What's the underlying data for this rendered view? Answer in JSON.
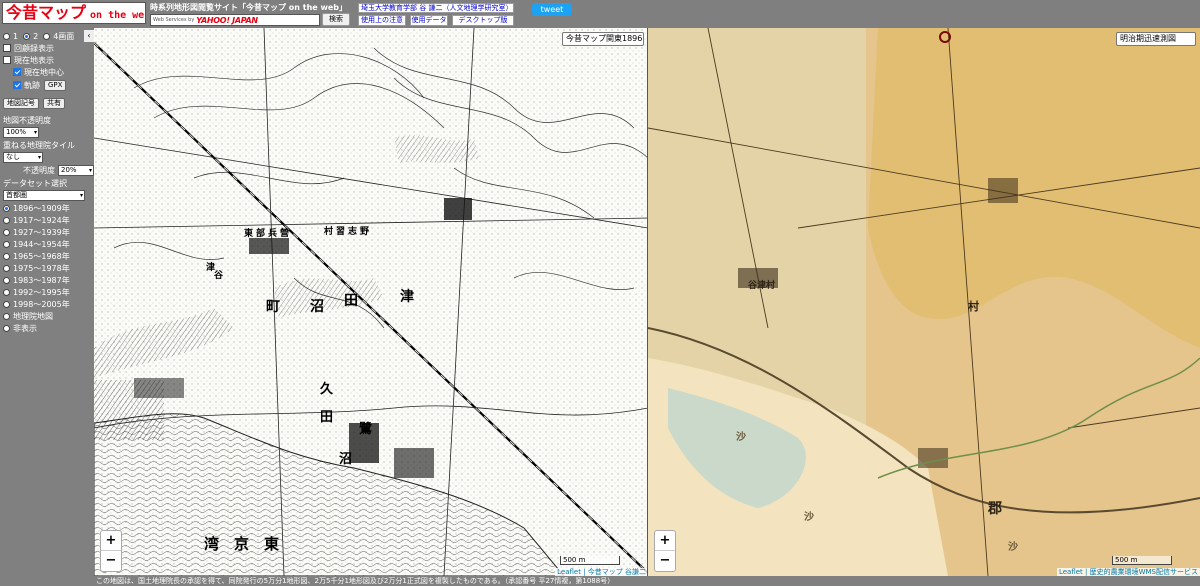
{
  "header": {
    "logo_main": "今昔マップ",
    "logo_sub": "on the web",
    "site_title": "時系列地形図閲覧サイト「今昔マップ on the web」",
    "yahoo_credit": "Web Services by",
    "yahoo_logo": "YAHOO! JAPAN",
    "search_value": "",
    "search_label": "検索",
    "author_link": "埼玉大学教育学部 谷 謙二（人文地理学研究室）",
    "notes_label": "使用上の注意",
    "data_label": "使用データ",
    "desktop_label": "デスクトップ版",
    "tweet_label": "tweet"
  },
  "sidebar": {
    "screen_options": [
      "1",
      "2",
      "4画面"
    ],
    "screen_selected": "2",
    "checks": [
      {
        "label": "回顧録表示",
        "checked": false
      },
      {
        "label": "現在地表示",
        "checked": false
      },
      {
        "label": "現在地中心",
        "checked": true
      },
      {
        "label": "軌跡",
        "checked": true
      }
    ],
    "gpx_label": "GPX",
    "legend_label": "地図記号",
    "share_label": "共有",
    "opacity_label": "地図不透明度",
    "opacity_value": "100%",
    "overlay_label": "重ねる地理院タイル",
    "overlay_value": "なし",
    "overlay_opacity_label": "不透明度",
    "overlay_opacity_value": "20%",
    "dataset_label": "データセット選択",
    "dataset_value": "首都圏",
    "periods": [
      "1896～1909年",
      "1917～1924年",
      "1927～1939年",
      "1944～1954年",
      "1965～1968年",
      "1975～1978年",
      "1983～1987年",
      "1992～1995年",
      "1998～2005年",
      "地理院地図",
      "非表示"
    ],
    "period_selected": 0,
    "collapse_label": "‹"
  },
  "map_left": {
    "layer_select": "今昔マップ関東1896",
    "zoom_in": "+",
    "zoom_out": "−",
    "scale": "500 m",
    "attribution": "Leaflet | 今昔マップ  谷謙二",
    "labels": [
      "東",
      "京",
      "湾",
      "津",
      "田",
      "沼",
      "町",
      "谷",
      "津",
      "久",
      "田",
      "鷺",
      "沼",
      "東",
      "部",
      "兵",
      "營",
      "村",
      "習",
      "志",
      "野"
    ]
  },
  "map_right": {
    "layer_select": "明治期迅速測図",
    "zoom_in": "+",
    "zoom_out": "−",
    "scale": "500 m",
    "attribution": "Leaflet | 歴史的農業環境WMS配信サービス",
    "labels": [
      "沙",
      "沙",
      "沙",
      "郡",
      "村",
      "谷津村"
    ]
  },
  "footer": {
    "text": "この地図は、国土地理院長の承認を得て、同院発行の5万分1地形図、2万5千分1地形図及び2万分1正式図を複製したものである。（承認番号 平27情複，第1088号）"
  },
  "colors": {
    "chrome": "#808080",
    "logo_red": "#e60012",
    "tweet_blue": "#1da1f2",
    "link_blue": "#0000cc",
    "old_map_bg": "#fbfbf8",
    "rapid_survey_bg": "#e5c58c",
    "sea_tint": "#f3e3bf"
  }
}
